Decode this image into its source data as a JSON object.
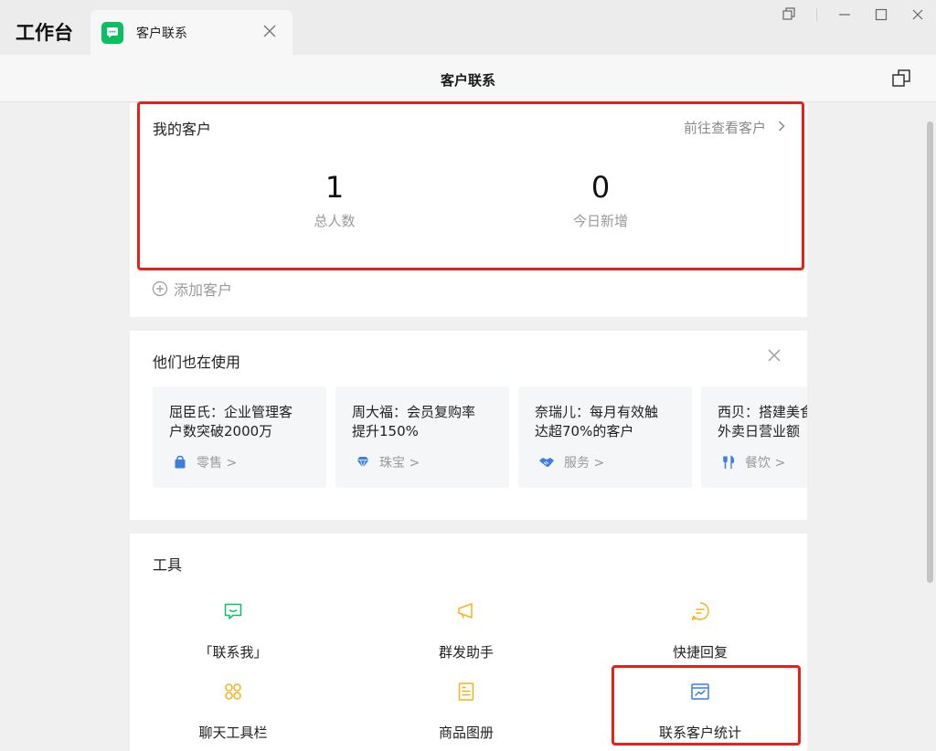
{
  "app": {
    "title": "工作台"
  },
  "tab": {
    "label": "客户联系"
  },
  "page": {
    "title": "客户联系"
  },
  "my_customers": {
    "title": "我的客户",
    "view_link": "前往查看客户",
    "stats": [
      {
        "value": "1",
        "label": "总人数"
      },
      {
        "value": "0",
        "label": "今日新增"
      }
    ],
    "add_label": "添加客户"
  },
  "cases": {
    "title": "他们也在使用",
    "items": [
      {
        "text": "屈臣氏：企业管理客\n户数突破2000万",
        "tag": "零售 >",
        "icon": "shopping-bag-icon"
      },
      {
        "text": "周大福：会员复购率\n提升150%",
        "tag": "珠宝 >",
        "icon": "diamond-icon"
      },
      {
        "text": "奈瑞儿：每月有效触\n达超70%的客户",
        "tag": "服务 >",
        "icon": "handshake-icon"
      },
      {
        "text": "西贝：搭建美食\n外卖日营业额",
        "tag": "餐饮 >",
        "icon": "fork-knife-icon"
      }
    ]
  },
  "tools": {
    "title": "工具",
    "items": [
      {
        "label": "「联系我」",
        "icon": "chat-bubble-icon",
        "color": "#07c160"
      },
      {
        "label": "群发助手",
        "icon": "megaphone-icon",
        "color": "#f5b21a"
      },
      {
        "label": "快捷回复",
        "icon": "quick-reply-icon",
        "color": "#f5b21a"
      },
      {
        "label": "聊天工具栏",
        "icon": "toolbar-icon",
        "color": "#f5b21a"
      },
      {
        "label": "商品图册",
        "icon": "catalog-icon",
        "color": "#f5b21a"
      },
      {
        "label": "联系客户统计",
        "icon": "statistics-icon",
        "color": "#3a7ee0"
      }
    ]
  },
  "colors": {
    "highlight": "#e8201a",
    "wechat_green": "#07c160",
    "tag_blue": "#3a7ee0"
  }
}
